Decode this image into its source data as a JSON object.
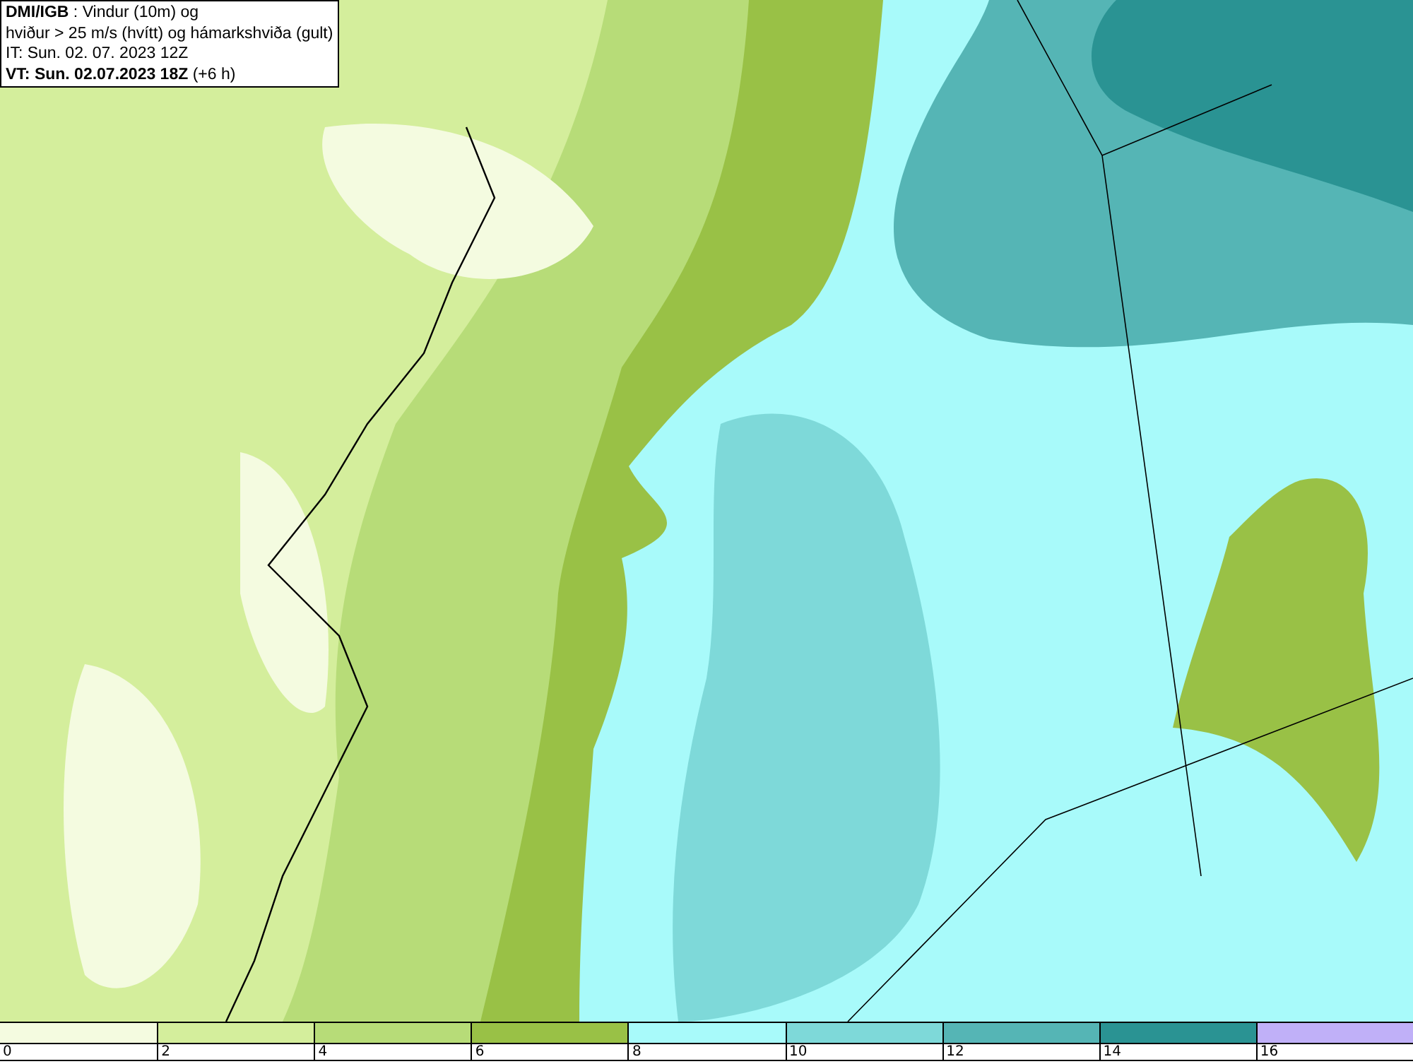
{
  "header": {
    "lines": [
      "**DMI/IGB** : Vindur (10m) og",
      "hviður > 25 m/s (hvítt) og hámarkshviða (gult)",
      "IT: Sun. 02. 07. 2023 12Z",
      "**VT: Sun. 02.07.2023 18Z** (+6 h)"
    ]
  },
  "legend": [
    {
      "label": "0",
      "color": "#f4fbe0"
    },
    {
      "label": "2",
      "color": "#d4ee9c"
    },
    {
      "label": "4",
      "color": "#b7dc78"
    },
    {
      "label": "6",
      "color": "#99c146"
    },
    {
      "label": "8",
      "color": "#a8fafa"
    },
    {
      "label": "10",
      "color": "#7ed9d9"
    },
    {
      "label": "12",
      "color": "#55b5b5"
    },
    {
      "label": "14",
      "color": "#2a9393"
    },
    {
      "label": "16",
      "color": "#c0b0f8"
    }
  ]
}
